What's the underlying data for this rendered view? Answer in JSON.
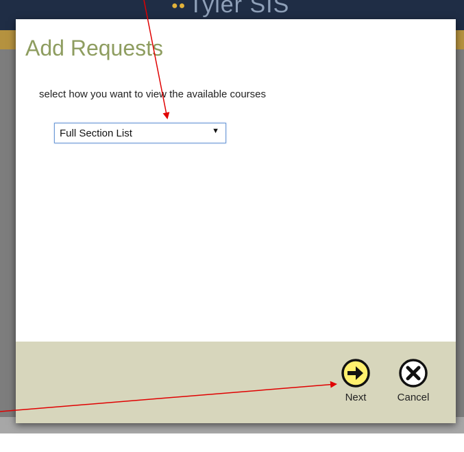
{
  "background": {
    "logo_text": "Tyler SIS"
  },
  "dialog": {
    "title": "Add Requests",
    "instruction": "select how you want to view the available courses",
    "view_select": {
      "selected": "Full Section List"
    },
    "buttons": {
      "next_label": "Next",
      "cancel_label": "Cancel"
    }
  },
  "colors": {
    "title": "#8e9d60",
    "footer": "#d7d6bc",
    "next_icon_fill": "#fff06e",
    "annotation_arrow": "#e00000"
  }
}
